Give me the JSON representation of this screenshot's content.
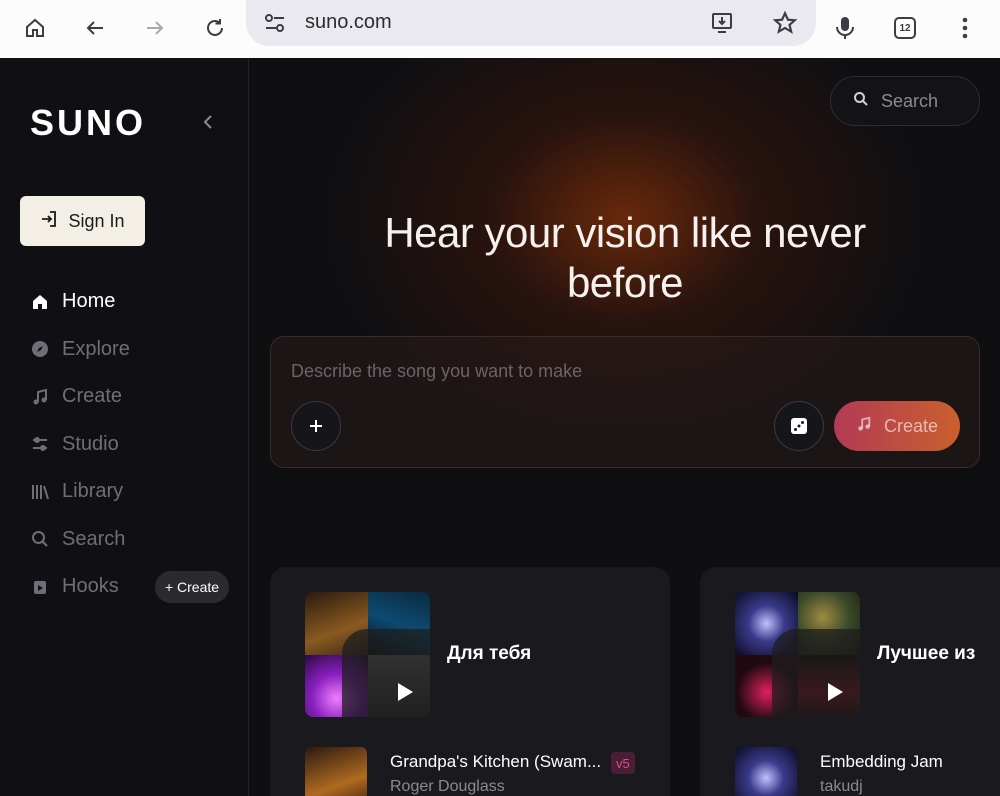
{
  "browser": {
    "url": "suno.com",
    "tab_count": "12"
  },
  "sidebar": {
    "logo": "SUNO",
    "sign_in": "Sign In",
    "items": [
      {
        "label": "Home",
        "icon": "home-icon"
      },
      {
        "label": "Explore",
        "icon": "compass-icon"
      },
      {
        "label": "Create",
        "icon": "music-note-icon"
      },
      {
        "label": "Studio",
        "icon": "sliders-icon"
      },
      {
        "label": "Library",
        "icon": "library-icon"
      },
      {
        "label": "Search",
        "icon": "search-icon"
      },
      {
        "label": "Hooks",
        "icon": "hooks-icon"
      }
    ],
    "hooks_create": "+ Create"
  },
  "main": {
    "search_label": "Search",
    "hero_line1": "Hear your vision like never",
    "hero_line2": "before",
    "prompt_placeholder": "Describe the song you want to make",
    "create_label": "Create",
    "cards": [
      {
        "title": "Для тебя",
        "song": {
          "name": "Grandpa's Kitchen (Swam...",
          "artist": "Roger Douglass",
          "badge": "v5"
        }
      },
      {
        "title": "Лучшее из",
        "song": {
          "name": "Embedding Jam",
          "artist": "takudj",
          "badge": ""
        }
      }
    ]
  },
  "colors": {
    "accent_gradient_start": "#b33a55",
    "accent_gradient_end": "#c9602e",
    "sign_in_bg": "#f4efe6"
  }
}
